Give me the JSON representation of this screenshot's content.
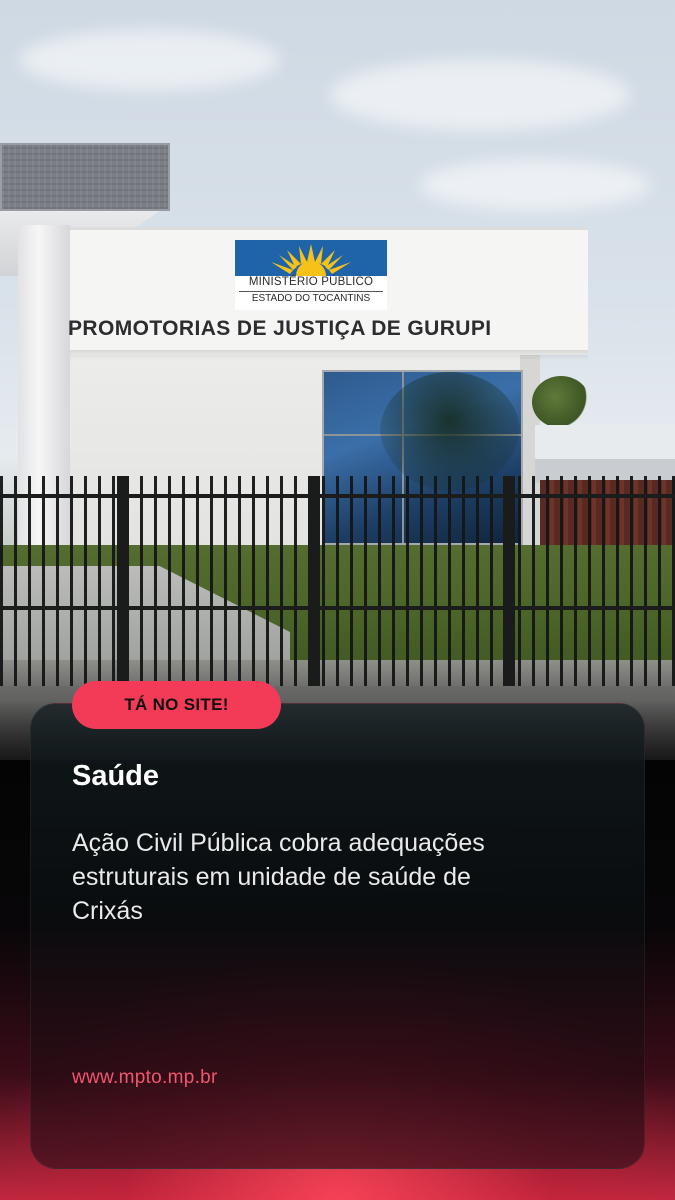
{
  "photo": {
    "logo_line1": "MINISTÉRIO PÚBLICO",
    "logo_line2": "ESTADO DO TOCANTINS",
    "building_sign": "PROMOTORIAS DE JUSTIÇA DE GURUPI"
  },
  "badge": {
    "label": "TÁ NO SITE!"
  },
  "card": {
    "category": "Saúde",
    "headline": "Ação Civil Pública cobra adequações estruturais em unidade de saúde de Crixás",
    "url": "www.mpto.mp.br"
  },
  "colors": {
    "accent": "#f33b58",
    "url_text": "#f0566e",
    "card_bg": "#0e1416"
  }
}
